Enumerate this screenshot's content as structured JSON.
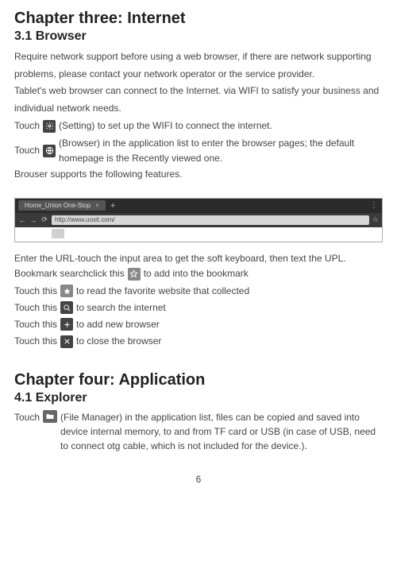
{
  "ch3_title": "Chapter three: Internet",
  "s31_title": "3.1 Browser",
  "p1": "Require network support before using a web browser, if there are network supporting problems, please contact your network operator or the service provider.",
  "p2": "Tablet's web browser can connect to the Internet. via WIFI to satisfy your business and individual network needs.",
  "p3a": "Touch",
  "p3b": "(Setting) to set up the WIFI to connect the internet.",
  "p4a": "Touch",
  "p4b": "(Browser) in the application list to enter the browser pages; the default homepage is the Recently viewed one.",
  "p5": "Brouser supports the following features.",
  "tab_label": "Home_Union One-Stop",
  "url_text": "http://www.uosit.com/",
  "f1": "Enter the URL-touch the input area to get the soft keyboard, then text the UPL.",
  "f2a": "Bookmark searchclick this",
  "f2b": "to add into the bookmark",
  "f3a": "Touch this",
  "f3b": "to read the favorite website that collected",
  "f4a": "Touch this",
  "f4b": "to search the internet",
  "f5a": "Touch this",
  "f5b": "to add new browser",
  "f6a": "Touch this",
  "f6b": "to close the browser",
  "ch4_title": "Chapter four: Application",
  "s41_title": "4.1 Explorer",
  "e1a": "Touch",
  "e1b": "(File Manager) in the application list, files can be copied and saved into device internal memory, to and from TF card or USB (in case of USB, need to connect otg cable, which is not included for the device.).",
  "page_number": "6"
}
